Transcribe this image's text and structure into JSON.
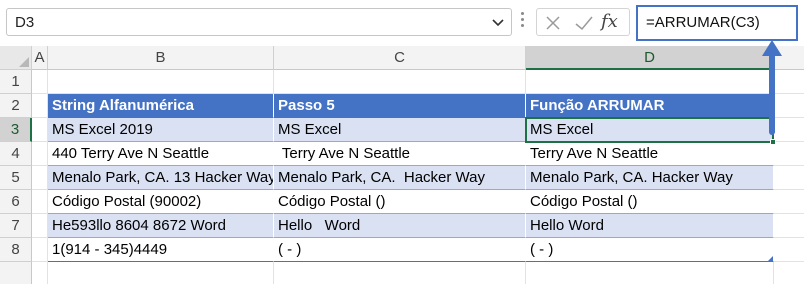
{
  "name_box": {
    "value": "D3"
  },
  "formula_bar": {
    "function_symbol": "fx",
    "value": "=ARRUMAR(C3)"
  },
  "columns": [
    "A",
    "B",
    "C",
    "D"
  ],
  "selected_column": "D",
  "rows": [
    "1",
    "2",
    "3",
    "4",
    "5",
    "6",
    "7",
    "8"
  ],
  "selected_row": "3",
  "active_cell": "D3",
  "table": {
    "headers": [
      "String Alfanumérica",
      "Passo 5",
      "Função ARRUMAR"
    ],
    "rows": [
      [
        "MS Excel 2019",
        "MS Excel",
        "MS Excel"
      ],
      [
        "440 Terry Ave N Seattle",
        " Terry Ave N Seattle",
        "Terry Ave N Seattle"
      ],
      [
        "Menalo Park, CA. 13 Hacker Way",
        "Menalo Park, CA.  Hacker Way",
        "Menalo Park, CA. Hacker Way"
      ],
      [
        "Código Postal (90002)",
        "Código Postal ()",
        "Código Postal ()"
      ],
      [
        "He593llo 8604 8672 Word",
        "Hello   Word",
        "Hello Word"
      ],
      [
        "1(914 - 345)4449",
        "( - )",
        "( - )"
      ]
    ]
  },
  "colors": {
    "table_header": "#4472c4",
    "band": "#d9e1f2",
    "active_border": "#1e7145",
    "arrow": "#4472c4"
  }
}
